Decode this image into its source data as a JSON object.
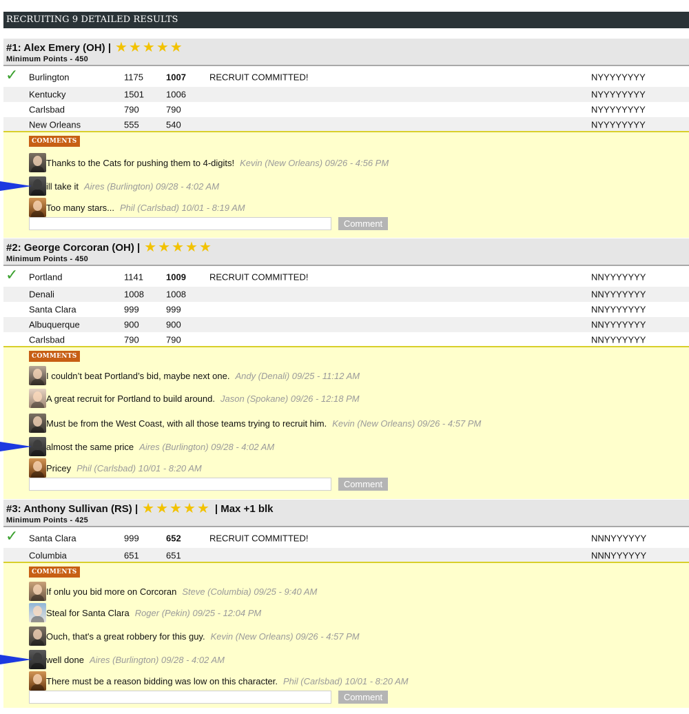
{
  "header": {
    "title": "RECRUITING 9 DETAILED RESULTS"
  },
  "colors": {
    "header_bg": "#2a3337",
    "star": "#f2c200",
    "check": "#3aa02e",
    "comments_bg": "#ffffcc",
    "comments_tag": "#c75f14",
    "pointer": "#1c39e0"
  },
  "recruits": [
    {
      "title": "#1: Alex Emery (OH) |",
      "stars": 5,
      "extra": "",
      "min_points": "Minimum Points - 450",
      "bids": [
        {
          "team": "Burlington",
          "bid": "1175",
          "points": "1007",
          "status": "RECRUIT COMMITTED!",
          "flags": "NYYYYYYYY",
          "winner": true
        },
        {
          "team": "Kentucky",
          "bid": "1501",
          "points": "1006",
          "status": "",
          "flags": "NYYYYYYYY",
          "winner": false
        },
        {
          "team": "Carlsbad",
          "bid": "790",
          "points": "790",
          "status": "",
          "flags": "NYYYYYYYY",
          "winner": false
        },
        {
          "team": "New Orleans",
          "bid": "555",
          "points": "540",
          "status": "",
          "flags": "NYYYYYYYY",
          "winner": false
        }
      ],
      "comments_label": "COMMENTS",
      "comments": [
        {
          "avatar": "kevin-avatar",
          "text": "Thanks to the Cats for pushing them to 4-digits!",
          "meta": "Kevin (New Orleans) 09/26 - 4:56 PM",
          "pointer": false
        },
        {
          "avatar": "aires-avatar",
          "text": "ill take it",
          "meta": "Aires (Burlington) 09/28 - 4:02 AM",
          "pointer": true
        },
        {
          "avatar": "phil-avatar",
          "text": "Too many stars...",
          "meta": "Phil (Carlsbad) 10/01 - 8:19 AM",
          "pointer": false
        }
      ],
      "input_placeholder": "",
      "button_label": "Comment"
    },
    {
      "title": "#2: George Corcoran (OH) |",
      "stars": 5,
      "extra": "",
      "min_points": "Minimum Points - 450",
      "bids": [
        {
          "team": "Portland",
          "bid": "1141",
          "points": "1009",
          "status": "RECRUIT COMMITTED!",
          "flags": "NNYYYYYYY",
          "winner": true
        },
        {
          "team": "Denali",
          "bid": "1008",
          "points": "1008",
          "status": "",
          "flags": "NNYYYYYYY",
          "winner": false
        },
        {
          "team": "Santa Clara",
          "bid": "999",
          "points": "999",
          "status": "",
          "flags": "NNYYYYYYY",
          "winner": false
        },
        {
          "team": "Albuquerque",
          "bid": "900",
          "points": "900",
          "status": "",
          "flags": "NNYYYYYYY",
          "winner": false
        },
        {
          "team": "Carlsbad",
          "bid": "790",
          "points": "790",
          "status": "",
          "flags": "NNYYYYYYY",
          "winner": false
        }
      ],
      "comments_label": "COMMENTS",
      "comments": [
        {
          "avatar": "andy-avatar",
          "text": "I couldn’t beat Portland’s bid, maybe next one.",
          "meta": "Andy (Denali) 09/25 - 11:12 AM",
          "pointer": false
        },
        {
          "avatar": "jason-avatar",
          "text": "A great recruit for Portland to build around.",
          "meta": "Jason (Spokane) 09/26 - 12:18 PM",
          "pointer": false
        },
        {
          "avatar": "kevin-avatar",
          "text": "Must be from the West Coast, with all those teams trying to recruit him.",
          "meta": "Kevin (New Orleans) 09/26 - 4:57 PM",
          "pointer": false
        },
        {
          "avatar": "aires-avatar",
          "text": "almost the same price",
          "meta": "Aires (Burlington) 09/28 - 4:02 AM",
          "pointer": true
        },
        {
          "avatar": "phil-avatar",
          "text": "Pricey",
          "meta": "Phil (Carlsbad) 10/01 - 8:20 AM",
          "pointer": false
        }
      ],
      "input_placeholder": "",
      "button_label": "Comment"
    },
    {
      "title": "#3: Anthony Sullivan (RS) |",
      "stars": 5,
      "extra": "| Max +1 blk",
      "min_points": "Minimum Points - 425",
      "bids": [
        {
          "team": "Santa Clara",
          "bid": "999",
          "points": "652",
          "status": "RECRUIT COMMITTED!",
          "flags": "NNNYYYYYY",
          "winner": true
        },
        {
          "team": "Columbia",
          "bid": "651",
          "points": "651",
          "status": "",
          "flags": "NNNYYYYYY",
          "winner": false
        }
      ],
      "comments_label": "COMMENTS",
      "comments": [
        {
          "avatar": "steve-avatar",
          "text": "If onlu you bid more on Corcoran",
          "meta": "Steve (Columbia) 09/25 - 9:40 AM",
          "pointer": false
        },
        {
          "avatar": "roger-avatar",
          "text": "Steal for Santa Clara",
          "meta": "Roger (Pekin) 09/25 - 12:04 PM",
          "pointer": false
        },
        {
          "avatar": "kevin-avatar",
          "text": "Ouch, that's a great robbery for this guy.",
          "meta": "Kevin (New Orleans) 09/26 - 4:57 PM",
          "pointer": false
        },
        {
          "avatar": "aires-avatar",
          "text": "well done",
          "meta": "Aires (Burlington) 09/28 - 4:02 AM",
          "pointer": true
        },
        {
          "avatar": "phil-avatar",
          "text": "There must be a reason bidding was low on this character.",
          "meta": "Phil (Carlsbad) 10/01 - 8:20 AM",
          "pointer": false
        }
      ],
      "input_placeholder": "",
      "button_label": "Comment"
    }
  ]
}
